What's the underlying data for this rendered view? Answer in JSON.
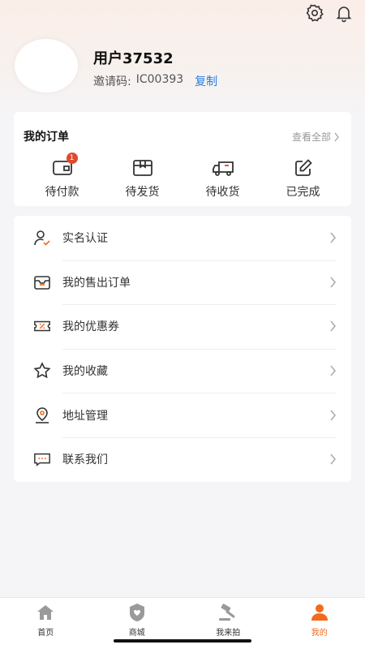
{
  "header": {
    "icons": [
      "settings-icon",
      "bell-icon"
    ]
  },
  "profile": {
    "username": "用户37532",
    "invite_label": "邀请码:",
    "invite_code": "IC00393",
    "copy_label": "复制"
  },
  "orders": {
    "title": "我的订单",
    "view_all": "查看全部",
    "items": [
      {
        "label": "待付款",
        "icon": "wallet-icon",
        "badge": "1"
      },
      {
        "label": "待发货",
        "icon": "package-icon"
      },
      {
        "label": "待收货",
        "icon": "truck-icon"
      },
      {
        "label": "已完成",
        "icon": "edit-icon"
      }
    ]
  },
  "menu": {
    "items": [
      {
        "label": "实名认证",
        "icon": "user-verified-icon"
      },
      {
        "label": "我的售出订单",
        "icon": "sold-orders-icon"
      },
      {
        "label": "我的优惠券",
        "icon": "coupon-icon"
      },
      {
        "label": "我的收藏",
        "icon": "star-icon"
      },
      {
        "label": "地址管理",
        "icon": "location-icon"
      },
      {
        "label": "联系我们",
        "icon": "chat-icon"
      }
    ]
  },
  "tabbar": {
    "items": [
      {
        "label": "首页",
        "icon": "home-icon"
      },
      {
        "label": "商城",
        "icon": "mall-icon"
      },
      {
        "label": "我来拍",
        "icon": "auction-gavel-icon"
      },
      {
        "label": "我的",
        "icon": "profile-icon",
        "active": true
      }
    ]
  },
  "colors": {
    "accent": "#f26a1b",
    "link": "#2a7de1",
    "badge": "#e0492e"
  }
}
